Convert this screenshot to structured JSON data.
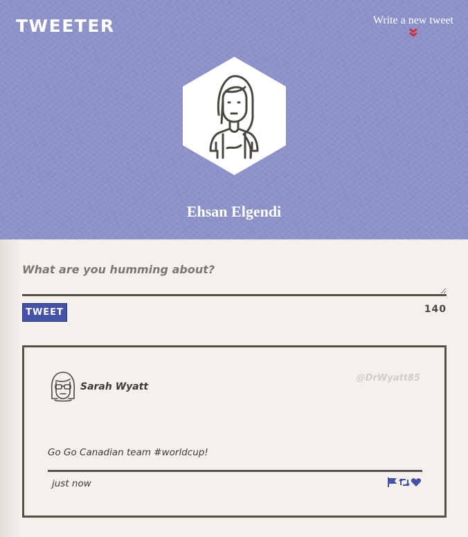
{
  "app": {
    "brand": "TWEETER",
    "compose_toggle_label": "Write a new tweet",
    "accent_color": "#4453a8",
    "header_color": "#8c91c9"
  },
  "profile": {
    "name": "Ehsan Elgendi",
    "avatar_icon": "woman-avatar-icon"
  },
  "composer": {
    "placeholder": "What are you humming about?",
    "value": "",
    "submit_label": "TWEET",
    "char_count": "140"
  },
  "tweets": [
    {
      "author": "Sarah Wyatt",
      "handle": "@DrWyatt85",
      "text": "Go Go Canadian team #worldcup!",
      "time": "just now",
      "avatar_icon": "glasses-avatar-icon",
      "actions": [
        "flag-icon",
        "retweet-icon",
        "heart-icon"
      ]
    }
  ]
}
